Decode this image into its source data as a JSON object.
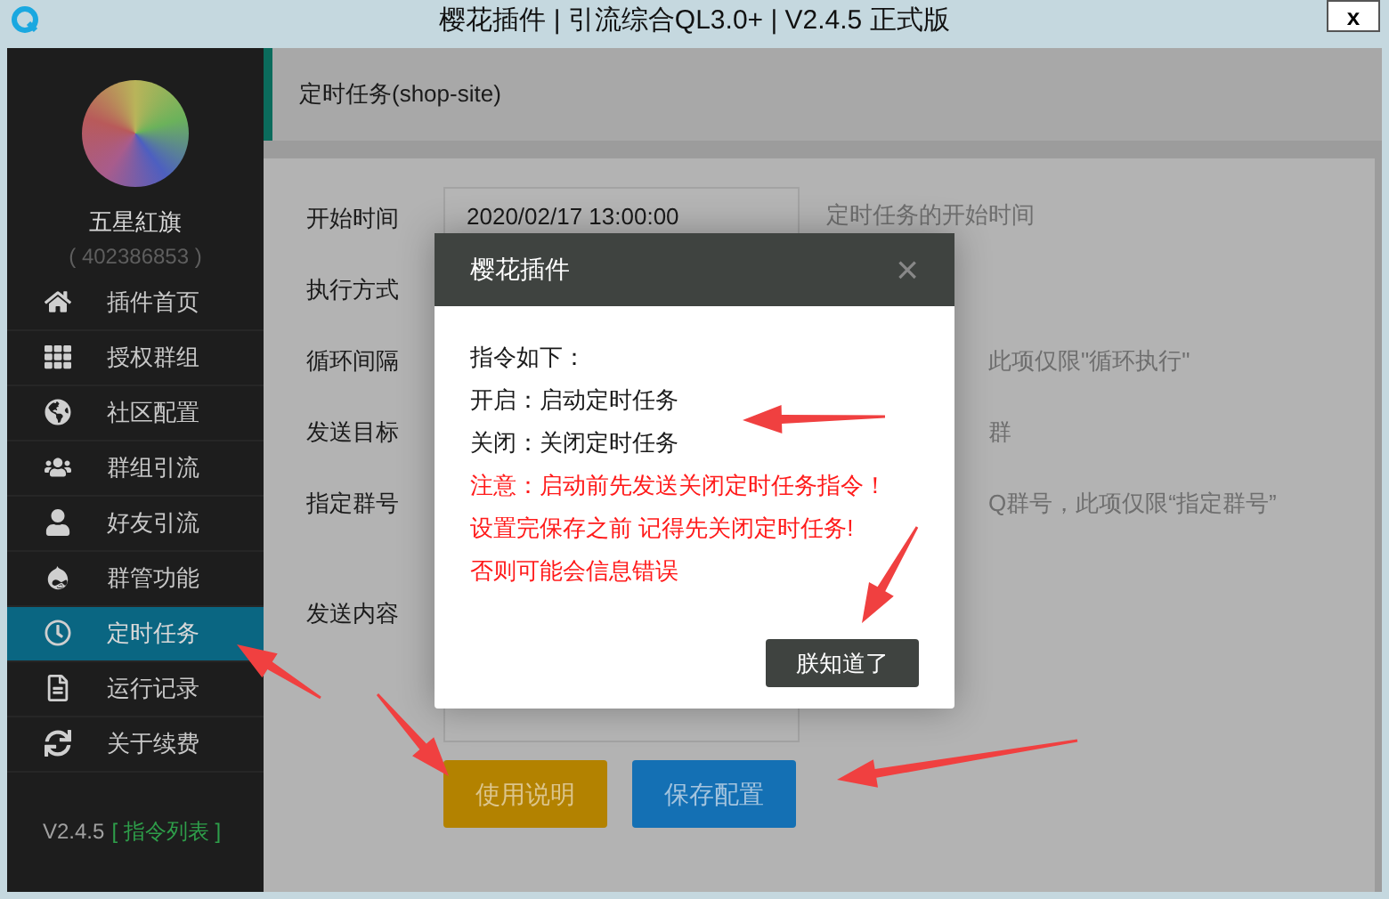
{
  "window": {
    "title": "樱花插件 | 引流综合QL3.0+ | V2.4.5 正式版",
    "close": "x"
  },
  "profile": {
    "name": "五星紅旗",
    "id": "( 402386853 )"
  },
  "sidebar": {
    "items": [
      {
        "label": "插件首页",
        "selected": false
      },
      {
        "label": "授权群组",
        "selected": false
      },
      {
        "label": "社区配置",
        "selected": false
      },
      {
        "label": "群组引流",
        "selected": false
      },
      {
        "label": "好友引流",
        "selected": false
      },
      {
        "label": "群管功能",
        "selected": false
      },
      {
        "label": "定时任务",
        "selected": true
      },
      {
        "label": "运行记录",
        "selected": false
      },
      {
        "label": "关于续费",
        "selected": false
      }
    ],
    "version": "V2.4.5",
    "link": "[ 指令列表 ]"
  },
  "page_title": "定时任务(shop-site)",
  "form": [
    {
      "label": "开始时间",
      "kind": "input",
      "value": "2020/02/17 13:00:00",
      "hint": "定时任务的开始时间"
    },
    {
      "label": "执行方式",
      "kind": "hidden"
    },
    {
      "label": "循环间隔",
      "kind": "partial",
      "hint": "此项仅限\"循环执行\""
    },
    {
      "label": "发送目标",
      "kind": "partial",
      "hint": "群"
    },
    {
      "label": "指定群号",
      "kind": "partial",
      "hint": "Q群号，此项仅限“指定群号”"
    },
    {
      "label": "发送内容",
      "kind": "textarea"
    }
  ],
  "buttons": [
    {
      "label": "使用说明",
      "kind": "help"
    },
    {
      "label": "保存配置",
      "kind": "save"
    }
  ],
  "dialog": {
    "title": "樱花插件",
    "close": "×",
    "lines": [
      {
        "text": "指令如下：",
        "kind": "normal"
      },
      {
        "text": "开启：启动定时任务",
        "kind": "normal"
      },
      {
        "text": "关闭：关闭定时任务",
        "kind": "normal"
      },
      {
        "text": "注意：启动前先发送关闭定时任务指令！",
        "kind": "warning"
      },
      {
        "text": "设置完保存之前 记得先关闭定时任务!",
        "kind": "warning"
      },
      {
        "text": "否则可能会信息错误",
        "kind": "warning"
      }
    ],
    "button": "朕知道了"
  }
}
